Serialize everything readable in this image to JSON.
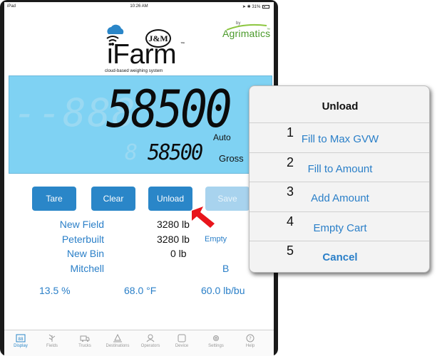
{
  "status_bar": {
    "device": "iPad",
    "time": "10:26 AM",
    "battery": "31%"
  },
  "logo": {
    "brand": "iFarm",
    "trademark": "™",
    "tagline": "cloud-based weighing system",
    "badge": "J&M"
  },
  "partner_logo": {
    "by": "by",
    "name": "Agrimatics",
    "trademark": "™"
  },
  "lcd": {
    "ghost_digits": "--888",
    "main_weight": "58500",
    "mode": "Auto",
    "small_ghost": "8",
    "secondary_weight": "58500",
    "weight_type": "Gross"
  },
  "buttons": {
    "tare": "Tare",
    "clear": "Clear",
    "unload": "Unload",
    "save": "Save"
  },
  "info": {
    "field": {
      "name": "New Field",
      "weight": "3280 lb"
    },
    "truck": {
      "name": "Peterbuilt",
      "weight": "3280 lb",
      "status": "Empty"
    },
    "bin": {
      "name": "New Bin",
      "weight": "0 lb"
    },
    "operator": {
      "name": "Mitchell",
      "code": "B"
    }
  },
  "stats": {
    "moisture": "13.5 %",
    "temperature": "68.0 °F",
    "test_weight": "60.0 lb/bu"
  },
  "tabs": [
    {
      "label": "Display",
      "icon": "display-icon"
    },
    {
      "label": "Fields",
      "icon": "fields-icon"
    },
    {
      "label": "Trucks",
      "icon": "truck-icon"
    },
    {
      "label": "Destinations",
      "icon": "destinations-icon"
    },
    {
      "label": "Operators",
      "icon": "operators-icon"
    },
    {
      "label": "Device",
      "icon": "device-icon"
    },
    {
      "label": "Settings",
      "icon": "settings-icon"
    },
    {
      "label": "Help",
      "icon": "help-icon"
    }
  ],
  "unload_menu": {
    "title": "Unload",
    "options": [
      {
        "number": "1",
        "label": "Fill to Max GVW"
      },
      {
        "number": "2",
        "label": "Fill to Amount"
      },
      {
        "number": "3",
        "label": "Add Amount"
      },
      {
        "number": "4",
        "label": "Empty Cart"
      },
      {
        "number": "5",
        "label": "Cancel"
      }
    ]
  },
  "colors": {
    "accent": "#2a86c8",
    "lcd_background": "#7fd2f3",
    "annotation_arrow": "#e8151b",
    "partner_green": "#4a9a2a"
  }
}
